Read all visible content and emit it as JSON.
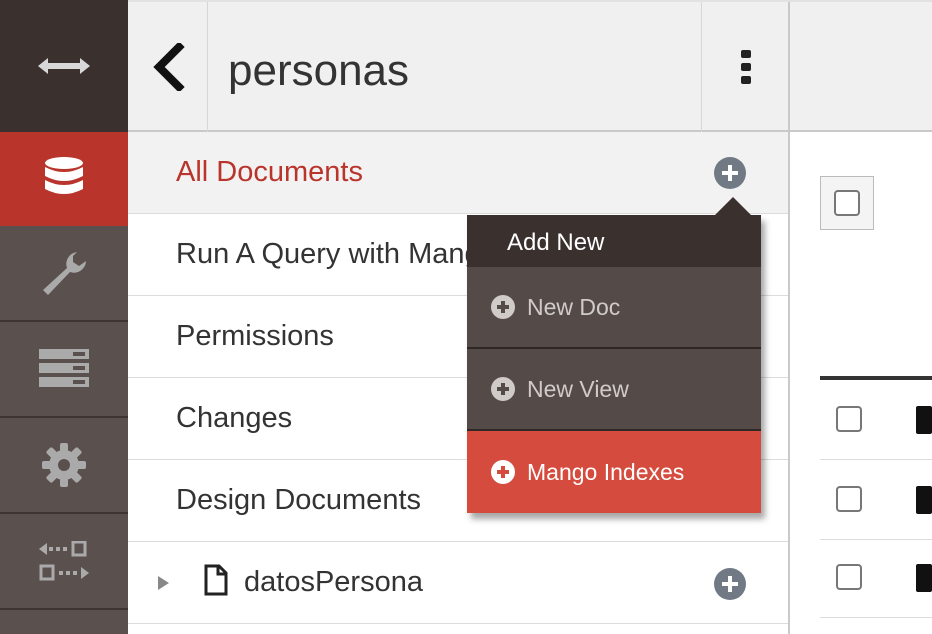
{
  "header": {
    "title": "personas"
  },
  "nav": {
    "items": [
      {
        "label": "All Documents"
      },
      {
        "label": "Run A Query with Mango"
      },
      {
        "label": "Permissions"
      },
      {
        "label": "Changes"
      },
      {
        "label": "Design Documents"
      }
    ],
    "tree": [
      {
        "label": "datosPersona"
      }
    ]
  },
  "dropdown": {
    "title": "Add New",
    "items": [
      {
        "label": "New Doc"
      },
      {
        "label": "New View"
      },
      {
        "label": "Mango Indexes"
      }
    ]
  },
  "colors": {
    "accent": "#b9342a",
    "danger": "#d54c3e",
    "rail": "#5a504d",
    "rail_dark": "#3a302e"
  },
  "icons": {
    "rail": [
      "expand-arrows-icon",
      "database-icon",
      "wrench-icon",
      "list-icon",
      "gear-icon",
      "replication-icon"
    ]
  }
}
